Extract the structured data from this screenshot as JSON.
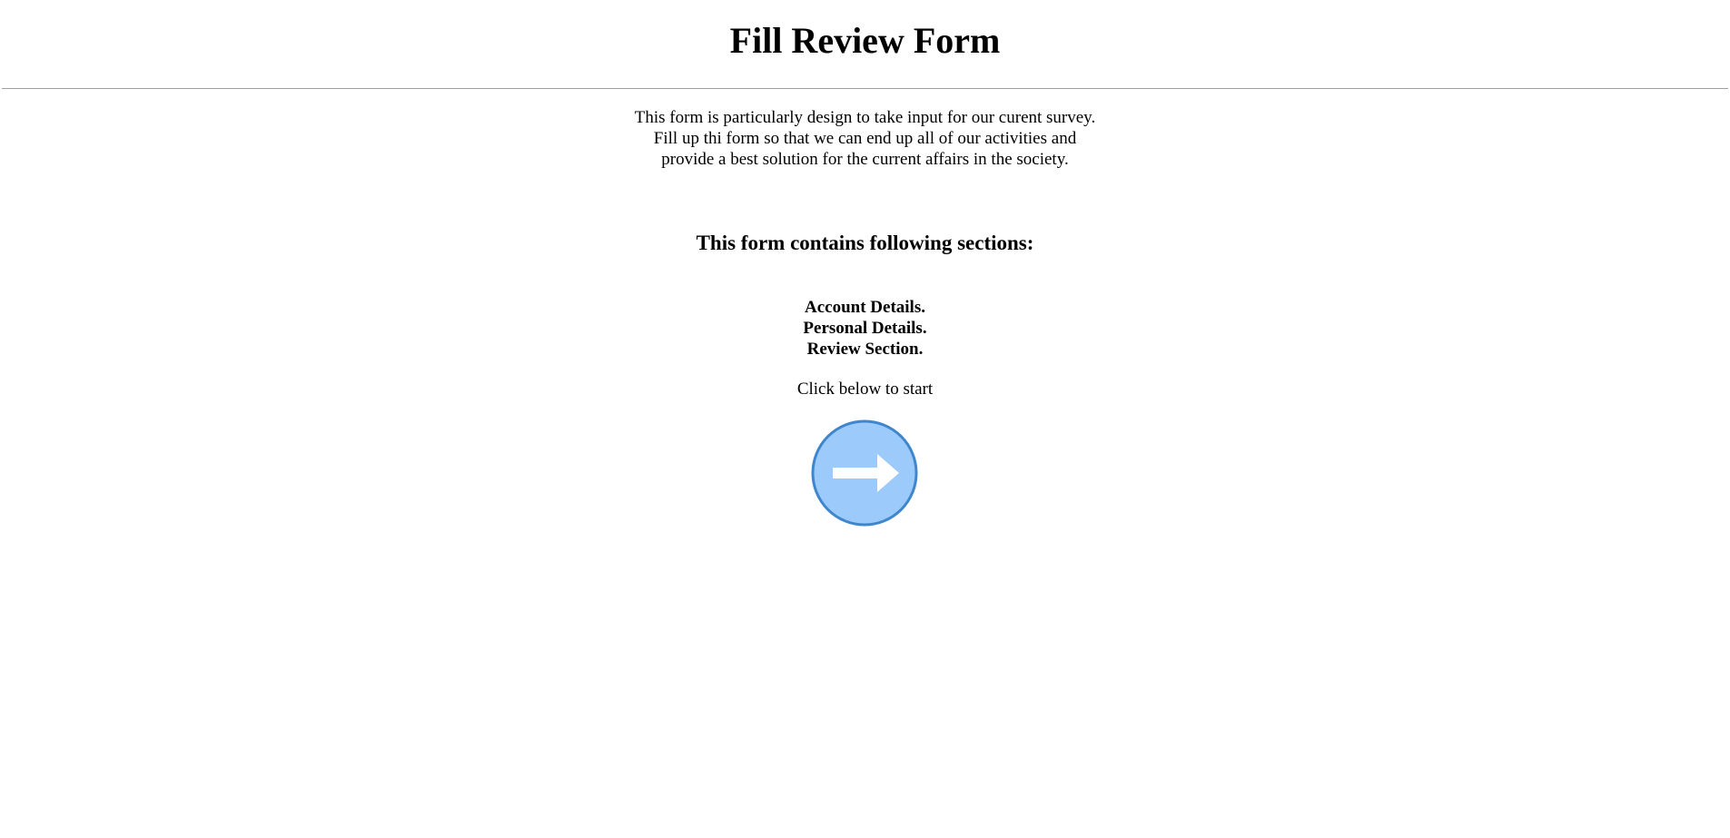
{
  "header": {
    "title": "Fill Review Form"
  },
  "intro": {
    "lines": [
      "This form is particularly design to take input for our curent survey.",
      "Fill up thi form so that we can end up all of our activities and",
      "provide a best solution for the current affairs in the society."
    ]
  },
  "sections": {
    "heading": "This form contains following sections:",
    "items": [
      "Account Details.",
      "Personal Details.",
      "Review Section."
    ]
  },
  "start": {
    "prompt": "Click below to start",
    "button_icon": "arrow-right-icon",
    "button_fill": "#9ccbfb",
    "button_border": "#3f86cc",
    "arrow_color": "#ffffff"
  }
}
